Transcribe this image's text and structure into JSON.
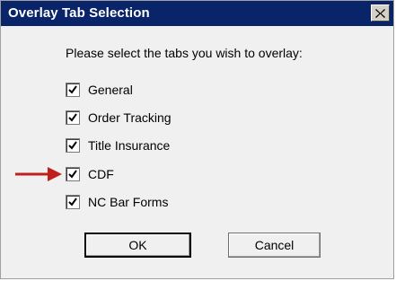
{
  "window": {
    "title": "Overlay Tab Selection"
  },
  "prompt": "Please select the tabs you wish to overlay:",
  "options": [
    {
      "label": "General",
      "checked": true
    },
    {
      "label": "Order Tracking",
      "checked": true
    },
    {
      "label": "Title Insurance",
      "checked": true
    },
    {
      "label": "CDF",
      "checked": true
    },
    {
      "label": "NC Bar Forms",
      "checked": true
    }
  ],
  "buttons": {
    "ok": "OK",
    "cancel": "Cancel"
  },
  "colors": {
    "titlebar": "#0a246a",
    "arrow": "#c0201c"
  }
}
